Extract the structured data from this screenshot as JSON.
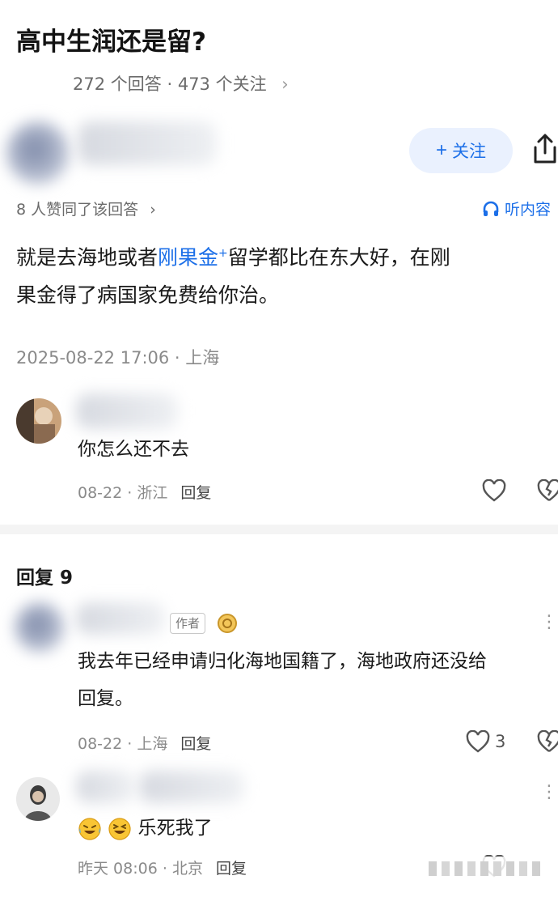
{
  "question": {
    "title": "高中生润还是留?",
    "answers_count": "272 个回答",
    "separator": "·",
    "followers_count": "473 个关注",
    "chevron": "›"
  },
  "answer_header": {
    "follow_plus": "+",
    "follow_label": "关注",
    "share_icon": "share-icon",
    "likes_text": "8 人赞同了该回答",
    "likes_chevron": "›",
    "listen_label": "听内容"
  },
  "answer": {
    "line1_pre": "就是去海地或者",
    "line1_link": "刚果金",
    "line1_sup": "+",
    "line1_post": "留学都比在东大好，在刚",
    "line2": "果金得了病国家免费给你治。",
    "time_location": "2025-08-22 17:06 · 上海"
  },
  "comment1": {
    "text": "你怎么还不去",
    "date": "08-22",
    "sep": "·",
    "location": "浙江",
    "reply": "回复"
  },
  "replies": {
    "title": "回复 9",
    "author_badge": "作者",
    "items": [
      {
        "line1": "我去年已经申请归化海地国籍了，海地政府还没给",
        "line2": "回复。",
        "date": "08-22",
        "sep": "·",
        "location": "上海",
        "reply": "回复",
        "likes": "3"
      },
      {
        "text": "乐死我了",
        "date": "昨天 08:06",
        "sep": "·",
        "location": "北京",
        "reply": "回复"
      }
    ]
  },
  "colors": {
    "accent": "#1c6fe8",
    "muted": "#8a8a8a"
  }
}
